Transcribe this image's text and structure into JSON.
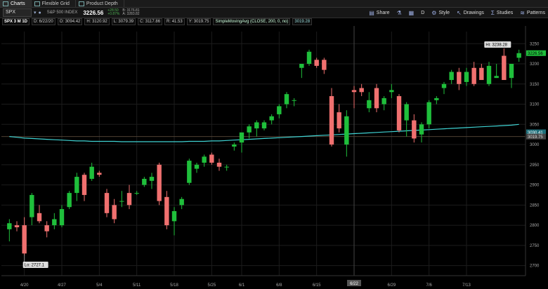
{
  "tabs": [
    {
      "label": "Charts",
      "active": true,
      "icon": "chart-icon"
    },
    {
      "label": "Flexible Grid",
      "active": false,
      "icon": "grid-icon"
    },
    {
      "label": "Product Depth",
      "active": false,
      "icon": "depth-icon"
    }
  ],
  "toolbar": {
    "symbol": "SPX",
    "index_name": "S&P 500 INDEX",
    "last_price": "3226.56",
    "change": "+28.50",
    "change_pct": "+0.87%",
    "bid": "B: 3176.81",
    "ask": "A: 3283.82",
    "share": "Share",
    "drawings": "Drawings",
    "studies": "Studies",
    "style": "Style",
    "patterns": "Patterns",
    "d_label": "D"
  },
  "infobar": {
    "title": "SPX 3 M 1D",
    "date": "D: 6/22/20",
    "open": "O: 3094.42",
    "high": "H: 3120.92",
    "low": "L: 3079.39",
    "close": "C: 3117.86",
    "range": "R: 41.53",
    "y": "Y: 3019.75",
    "sma_label": "SimpleMovingAvg (CLOSE, 200, 0, no)",
    "sma_value": "3019.28"
  },
  "colors": {
    "up": "#1fbf3b",
    "down": "#f0706f",
    "sma": "#3fd3d3",
    "bg": "#000000",
    "grid": "#1c1c1c",
    "axis_text": "#aaaaaa"
  },
  "chart_data": {
    "type": "candlestick",
    "title": "SPX 3 M 1D",
    "y_ticks": [
      2700,
      2750,
      2800,
      2850,
      2900,
      2950,
      3000,
      3050,
      3100,
      3150,
      3200,
      3250
    ],
    "ylim": [
      2675,
      3280
    ],
    "x_ticks": [
      {
        "label": "4/20",
        "index": 2
      },
      {
        "label": "4/27",
        "index": 7
      },
      {
        "label": "5/4",
        "index": 12
      },
      {
        "label": "5/11",
        "index": 17
      },
      {
        "label": "5/18",
        "index": 22
      },
      {
        "label": "5/25",
        "index": 27
      },
      {
        "label": "6/1",
        "index": 31
      },
      {
        "label": "6/8",
        "index": 36
      },
      {
        "label": "6/15",
        "index": 41
      },
      {
        "label": "6/22",
        "index": 46
      },
      {
        "label": "6/29",
        "index": 51
      },
      {
        "label": "7/6",
        "index": 56
      },
      {
        "label": "7/13",
        "index": 61
      }
    ],
    "crosshair_index": 46,
    "candles": [
      {
        "o": 2790,
        "h": 2815,
        "l": 2760,
        "c": 2805
      },
      {
        "o": 2800,
        "h": 2810,
        "l": 2785,
        "c": 2795
      },
      {
        "o": 2800,
        "h": 2820,
        "l": 2725,
        "c": 2730
      },
      {
        "o": 2820,
        "h": 2880,
        "l": 2800,
        "c": 2875
      },
      {
        "o": 2830,
        "h": 2850,
        "l": 2805,
        "c": 2810
      },
      {
        "o": 2800,
        "h": 2810,
        "l": 2770,
        "c": 2785
      },
      {
        "o": 2800,
        "h": 2830,
        "l": 2790,
        "c": 2815
      },
      {
        "o": 2800,
        "h": 2850,
        "l": 2795,
        "c": 2840
      },
      {
        "o": 2845,
        "h": 2885,
        "l": 2840,
        "c": 2880
      },
      {
        "o": 2880,
        "h": 2930,
        "l": 2860,
        "c": 2920
      },
      {
        "o": 2925,
        "h": 2930,
        "l": 2860,
        "c": 2875
      },
      {
        "o": 2915,
        "h": 2955,
        "l": 2910,
        "c": 2945
      },
      {
        "o": 2930,
        "h": 2935,
        "l": 2920,
        "c": 2925
      },
      {
        "o": 2880,
        "h": 2890,
        "l": 2820,
        "c": 2830
      },
      {
        "o": 2850,
        "h": 2865,
        "l": 2805,
        "c": 2815
      },
      {
        "o": 2860,
        "h": 2885,
        "l": 2845,
        "c": 2860
      },
      {
        "o": 2880,
        "h": 2900,
        "l": 2840,
        "c": 2850
      },
      {
        "o": 2880,
        "h": 2885,
        "l": 2875,
        "c": 2880
      },
      {
        "o": 2900,
        "h": 2920,
        "l": 2895,
        "c": 2915
      },
      {
        "o": 2910,
        "h": 2930,
        "l": 2890,
        "c": 2920
      },
      {
        "o": 2950,
        "h": 2955,
        "l": 2850,
        "c": 2860
      },
      {
        "o": 2870,
        "h": 2885,
        "l": 2790,
        "c": 2800
      },
      {
        "o": 2810,
        "h": 2845,
        "l": 2775,
        "c": 2835
      },
      {
        "o": 2850,
        "h": 2870,
        "l": 2840,
        "c": 2865
      },
      {
        "o": 2905,
        "h": 2965,
        "l": 2900,
        "c": 2960
      },
      {
        "o": 2940,
        "h": 2955,
        "l": 2930,
        "c": 2950
      },
      {
        "o": 2955,
        "h": 2975,
        "l": 2945,
        "c": 2970
      },
      {
        "o": 2975,
        "h": 2980,
        "l": 2950,
        "c": 2955
      },
      {
        "o": 2955,
        "h": 2965,
        "l": 2935,
        "c": 2945
      },
      {
        "o": 2945,
        "h": 2950,
        "l": 2935,
        "c": 2945
      },
      {
        "o": 2995,
        "h": 3005,
        "l": 2985,
        "c": 3000
      },
      {
        "o": 3005,
        "h": 3020,
        "l": 2980,
        "c": 3030
      },
      {
        "o": 3030,
        "h": 3050,
        "l": 3015,
        "c": 3045
      },
      {
        "o": 3040,
        "h": 3060,
        "l": 3020,
        "c": 3055
      },
      {
        "o": 3040,
        "h": 3060,
        "l": 3035,
        "c": 3055
      },
      {
        "o": 3060,
        "h": 3075,
        "l": 3050,
        "c": 3070
      },
      {
        "o": 3075,
        "h": 3100,
        "l": 3065,
        "c": 3095
      },
      {
        "o": 3100,
        "h": 3130,
        "l": 3090,
        "c": 3125
      },
      {
        "o": 3110,
        "h": 3115,
        "l": 3095,
        "c": 3110
      },
      {
        "o": 3190,
        "h": 3200,
        "l": 3165,
        "c": 3200
      },
      {
        "o": 3200,
        "h": 3235,
        "l": 3195,
        "c": 3230
      },
      {
        "o": 3210,
        "h": 3215,
        "l": 3190,
        "c": 3195
      },
      {
        "o": 3210,
        "h": 3215,
        "l": 3175,
        "c": 3185
      },
      {
        "o": 3120,
        "h": 3140,
        "l": 2995,
        "c": 3000
      },
      {
        "o": 3080,
        "h": 3100,
        "l": 3030,
        "c": 3040
      },
      {
        "o": 3000,
        "h": 3085,
        "l": 2970,
        "c": 3070
      },
      {
        "o": 3135,
        "h": 3145,
        "l": 3090,
        "c": 3130
      },
      {
        "o": 3140,
        "h": 3150,
        "l": 3120,
        "c": 3130
      },
      {
        "o": 3090,
        "h": 3130,
        "l": 3080,
        "c": 3110
      },
      {
        "o": 3140,
        "h": 3150,
        "l": 3080,
        "c": 3090
      },
      {
        "o": 3100,
        "h": 3120,
        "l": 3085,
        "c": 3115
      },
      {
        "o": 3130,
        "h": 3150,
        "l": 3115,
        "c": 3135
      },
      {
        "o": 3120,
        "h": 3125,
        "l": 3030,
        "c": 3035
      },
      {
        "o": 3060,
        "h": 3105,
        "l": 3020,
        "c": 3100
      },
      {
        "o": 3060,
        "h": 3075,
        "l": 3005,
        "c": 3015
      },
      {
        "o": 3025,
        "h": 3055,
        "l": 3005,
        "c": 3050
      },
      {
        "o": 3050,
        "h": 3110,
        "l": 3040,
        "c": 3105
      },
      {
        "o": 3110,
        "h": 3120,
        "l": 3100,
        "c": 3115
      },
      {
        "o": 3140,
        "h": 3155,
        "l": 3125,
        "c": 3150
      },
      {
        "o": 3160,
        "h": 3185,
        "l": 3150,
        "c": 3180
      },
      {
        "o": 3180,
        "h": 3190,
        "l": 3135,
        "c": 3150
      },
      {
        "o": 3155,
        "h": 3190,
        "l": 3145,
        "c": 3180
      },
      {
        "o": 3190,
        "h": 3205,
        "l": 3145,
        "c": 3150
      },
      {
        "o": 3190,
        "h": 3200,
        "l": 3165,
        "c": 3160
      },
      {
        "o": 3150,
        "h": 3205,
        "l": 3145,
        "c": 3195
      },
      {
        "o": 3165,
        "h": 3200,
        "l": 3165,
        "c": 3170
      },
      {
        "o": 3220,
        "h": 3238.28,
        "l": 3165,
        "c": 3160
      },
      {
        "o": 3165,
        "h": 3200,
        "l": 3140,
        "c": 3200
      },
      {
        "o": 3215,
        "h": 3235,
        "l": 3205,
        "c": 3226.56
      }
    ],
    "sma_series": [
      3020,
      3018,
      3016,
      3015,
      3014,
      3013,
      3012,
      3011,
      3010,
      3009,
      3009,
      3008,
      3008,
      3008,
      3008,
      3007,
      3007,
      3007,
      3007,
      3007,
      3007,
      3007,
      3007,
      3007,
      3008,
      3008,
      3008,
      3009,
      3009,
      3010,
      3011,
      3012,
      3013,
      3014,
      3015,
      3016,
      3017,
      3018,
      3019,
      3020,
      3021,
      3022,
      3023,
      3024,
      3025,
      3026,
      3027,
      3028,
      3029,
      3030,
      3031,
      3032,
      3033,
      3034,
      3035,
      3036,
      3037,
      3038,
      3039,
      3040,
      3041,
      3042,
      3043,
      3044,
      3045,
      3046,
      3047,
      3048,
      3050
    ],
    "hi_label": "Hi: 3238.28",
    "lo_label": "Lo: 2727.1",
    "last_price_tag": "3226.56",
    "sma_tag": "3030.41",
    "y_tag": "3019.75",
    "crosshair_date_tag": "6/22"
  }
}
